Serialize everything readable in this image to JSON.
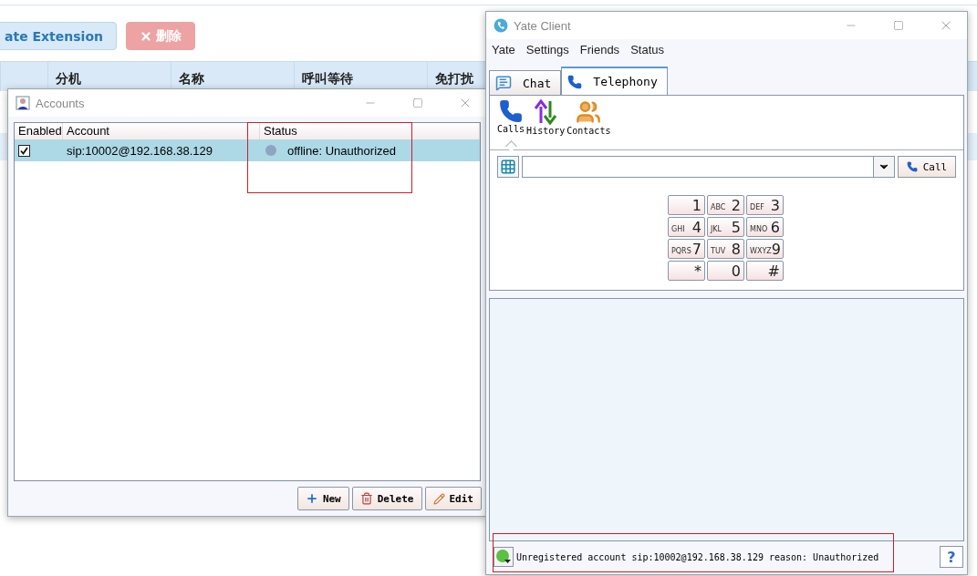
{
  "background_page": {
    "buttons": [
      {
        "label": "ate Extension",
        "kind": "primary"
      },
      {
        "label": "删除",
        "kind": "danger"
      }
    ],
    "table": {
      "columns": [
        "分机",
        "名称",
        "呼叫等待",
        "免打扰"
      ]
    }
  },
  "accounts_window": {
    "title": "Accounts",
    "columns": [
      "Enabled",
      "Account",
      "Status"
    ],
    "rows": [
      {
        "enabled": true,
        "account": "sip:10002@192.168.38.129",
        "status": "offline: Unauthorized",
        "selected": true
      }
    ],
    "buttons": [
      {
        "label": "New",
        "kind": "new"
      },
      {
        "label": "Delete",
        "kind": "delete"
      },
      {
        "label": "Edit",
        "kind": "edit"
      }
    ]
  },
  "yate_window": {
    "title": "Yate Client",
    "menu": [
      "Yate",
      "Settings",
      "Friends",
      "Status"
    ],
    "tabs": [
      {
        "label": "Chat",
        "kind": "chat",
        "selected": false
      },
      {
        "label": "Telephony",
        "kind": "telephony",
        "selected": true
      }
    ],
    "tools": [
      {
        "label": "Calls",
        "kind": "calls",
        "selected": true
      },
      {
        "label": "History",
        "kind": "history",
        "selected": false
      },
      {
        "label": "Contacts",
        "kind": "contacts",
        "selected": false
      }
    ],
    "call_button": "Call",
    "keypad": [
      {
        "digit": "1"
      },
      {
        "digit": "2",
        "letters": "ABC"
      },
      {
        "digit": "3",
        "letters": "DEF"
      },
      {
        "digit": "4",
        "letters": "GHI"
      },
      {
        "digit": "5",
        "letters": "JKL"
      },
      {
        "digit": "6",
        "letters": "MNO"
      },
      {
        "digit": "7",
        "letters": "PQRS"
      },
      {
        "digit": "8",
        "letters": "TUV"
      },
      {
        "digit": "9",
        "letters": "WXYZ"
      },
      {
        "digit": "*"
      },
      {
        "digit": "0"
      },
      {
        "digit": "#"
      }
    ],
    "status_text": "Unregistered account sip:10002@192.168.38.129 reason: Unauthorized",
    "help_button": "?"
  }
}
